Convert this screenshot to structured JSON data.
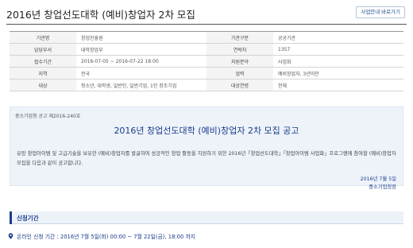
{
  "page": {
    "title": "2016년 창업선도대학 (예비)창업자 2차 모집",
    "guide_button": "사업안내 바로가기"
  },
  "info": [
    [
      {
        "label": "기관명",
        "value": "창업진흥원"
      },
      {
        "label": "기관구분",
        "value": "공공기관"
      }
    ],
    [
      {
        "label": "담당부서",
        "value": "대학창업부"
      },
      {
        "label": "연락처",
        "value": "1357"
      }
    ],
    [
      {
        "label": "접수기간",
        "value": "2016-07-05 ~ 2016-07-22 18:00"
      },
      {
        "label": "지원분야",
        "value": "사업화"
      }
    ],
    [
      {
        "label": "지역",
        "value": "전국"
      },
      {
        "label": "업력",
        "value": "예비창업자, 3년미만"
      }
    ],
    [
      {
        "label": "대상",
        "value": "청소년, 대학생, 일반인, 일반기업, 1인 창조기업"
      },
      {
        "label": "대상연령",
        "value": "전체"
      }
    ]
  ],
  "notice": {
    "number": "중소기업청 공고 제2016-240호",
    "title": "2016년 창업선도대학 (예비)창업자 2차 모집 공고",
    "body": "유망 창업아이템 및 고급기술을 보유한 (예비)창업자를 발굴하여 성공적인 창업 활동을 지원하기 위한 2016년「창업선도대학」「창업아이템 사업화」프로그램에 참여할 (예비)창업자 모집을 다음과 같이 공고합니다.",
    "date": "2016년 7월 5일",
    "org": "중소기업청장"
  },
  "section": {
    "label": "신청기간"
  },
  "period": {
    "text": "온라인 신청 기간 : 2016년 7월 5일(화) 00:00 ~ 7월 22일(금), 18:00 까지",
    "icon": "location-pin-icon"
  },
  "colors": {
    "accent": "#1a3c8a",
    "notice_bg": "#eef3fa"
  }
}
